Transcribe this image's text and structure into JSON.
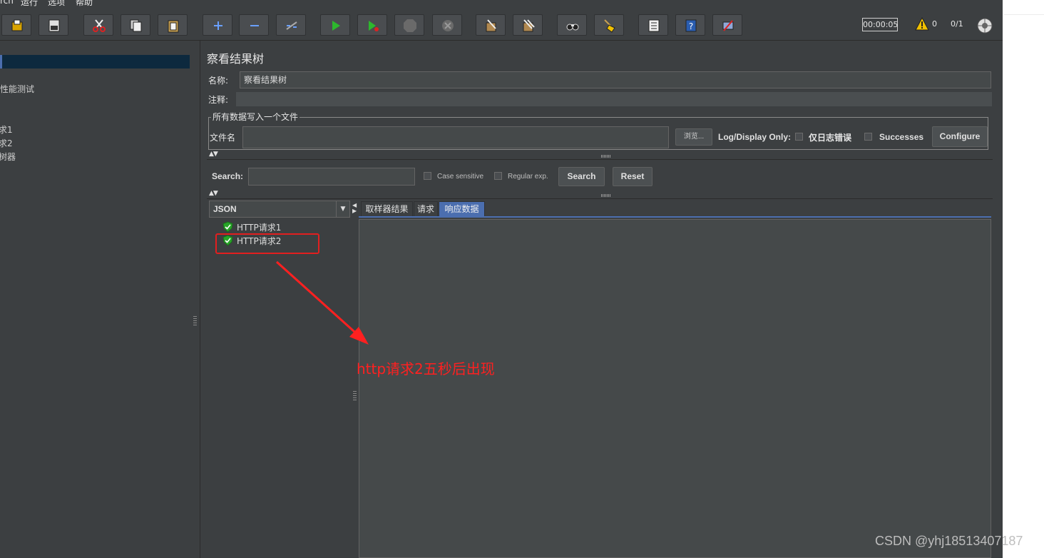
{
  "menubar": {
    "items": [
      "rch",
      "运行",
      "选项",
      "帮助"
    ]
  },
  "toolbar": {
    "buttons": [
      "open-icon",
      "save-icon",
      "cut-icon",
      "copy-icon",
      "paste-icon",
      "expand-icon",
      "collapse-icon",
      "toggle-icon",
      "start-icon",
      "start-no-pause-icon",
      "stop-icon",
      "shutdown-icon",
      "clear-icon",
      "clear-all-icon",
      "search-icon",
      "reset-search-icon",
      "function-helper-icon",
      "help-icon",
      "remote-icon"
    ],
    "timer": "00:00:05",
    "warning_count": "0",
    "threads": "0/1"
  },
  "left_tree": {
    "items": [
      "性能测试",
      "求1",
      "求2",
      "树器"
    ]
  },
  "panel": {
    "title": "察看结果树",
    "name_label": "名称:",
    "name_value": "察看结果树",
    "comment_label": "注释:",
    "comment_value": "",
    "file_group_title": "所有数据写入一个文件",
    "filename_label": "文件名",
    "filename_value": "",
    "browse_label": "浏览...",
    "log_display_label": "Log/Display Only:",
    "errors_label": "仅日志错误",
    "successes_label": "Successes",
    "configure_label": "Configure"
  },
  "search": {
    "label": "Search:",
    "value": "",
    "case_sensitive_label": "Case sensitive",
    "regex_label": "Regular exp.",
    "search_button": "Search",
    "reset_button": "Reset"
  },
  "results": {
    "renderer": "JSON",
    "items": [
      "HTTP请求1",
      "HTTP请求2"
    ],
    "tabs": [
      "取样器结果",
      "请求",
      "响应数据"
    ],
    "active_tab": "响应数据"
  },
  "annotation": {
    "text": "http请求2五秒后出现"
  },
  "watermark": "CSDN @yhj18513407187",
  "colors": {
    "annotation": "#ff2020",
    "selection": "#4b6eaf",
    "background": "#3c3f41"
  }
}
